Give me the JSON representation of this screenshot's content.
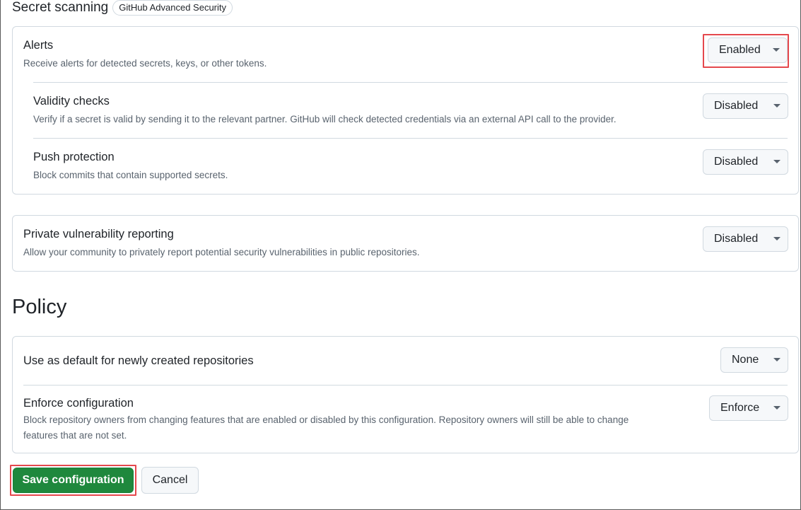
{
  "secret_scanning": {
    "title": "Secret scanning",
    "badge": "GitHub Advanced Security",
    "alerts": {
      "title": "Alerts",
      "description": "Receive alerts for detected secrets, keys, or other tokens.",
      "value": "Enabled"
    },
    "validity_checks": {
      "title": "Validity checks",
      "description": "Verify if a secret is valid by sending it to the relevant partner. GitHub will check detected credentials via an external API call to the provider.",
      "value": "Disabled"
    },
    "push_protection": {
      "title": "Push protection",
      "description": "Block commits that contain supported secrets.",
      "value": "Disabled"
    }
  },
  "private_vulnerability_reporting": {
    "title": "Private vulnerability reporting",
    "description": "Allow your community to privately report potential security vulnerabilities in public repositories.",
    "value": "Disabled"
  },
  "policy": {
    "title": "Policy",
    "default_for_new": {
      "title": "Use as default for newly created repositories",
      "value": "None"
    },
    "enforce": {
      "title": "Enforce configuration",
      "description_line1": "Block repository owners from changing features that are enabled or disabled by this configuration. Repository owners will still be able to change",
      "description_line2": "features that are not set.",
      "value": "Enforce"
    }
  },
  "actions": {
    "save_label": "Save configuration",
    "cancel_label": "Cancel"
  },
  "colors": {
    "primary_button": "#1f883d",
    "highlight": "#e5484d",
    "border": "#d1d9e0"
  }
}
